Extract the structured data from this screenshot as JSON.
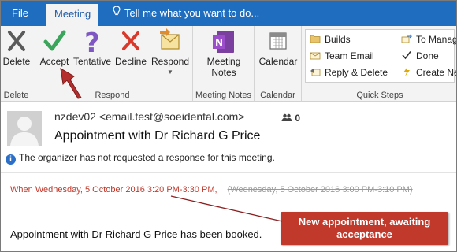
{
  "tabs": {
    "file": "File",
    "meeting": "Meeting",
    "tell_me": "Tell me what you want to do..."
  },
  "ribbon": {
    "delete_group": {
      "label": "Delete",
      "delete": "Delete"
    },
    "respond_group": {
      "label": "Respond",
      "accept": "Accept",
      "tentative": "Tentative",
      "decline": "Decline",
      "respond": "Respond"
    },
    "notes_group": {
      "label": "Meeting Notes",
      "meeting_notes_line1": "Meeting",
      "meeting_notes_line2": "Notes"
    },
    "calendar_group": {
      "label": "Calendar",
      "calendar": "Calendar"
    },
    "quick_steps": {
      "label": "Quick Steps",
      "items": [
        "Builds",
        "Team Email",
        "Reply & Delete",
        "To Manag",
        "Done",
        "Create Ne"
      ]
    }
  },
  "message": {
    "sender": "nzdev02 <email.test@soeidental.com>",
    "attendee_count": "0",
    "subject": "Appointment with Dr Richard G Price",
    "notice": "The organizer has not requested a response for this meeting.",
    "when_label": "When",
    "when_new": "Wednesday, 5 October 2016 3:20 PM-3:30 PM,",
    "when_old": "(Wednesday, 5 October 2016 3:00 PM-3:10 PM)",
    "body": "Appointment with Dr Richard G Price has been booked."
  },
  "annotation": {
    "callout_line1": "New appointment, awaiting",
    "callout_line2": "acceptance"
  },
  "colors": {
    "title_bar": "#1f6dbf",
    "ribbon_bg": "#f3f3f3",
    "accept_green": "#3aa55b",
    "tentative_purple": "#7e57c2",
    "decline_red": "#d9392b",
    "annotation_red": "#c0392b",
    "when_red": "#c0392b"
  }
}
